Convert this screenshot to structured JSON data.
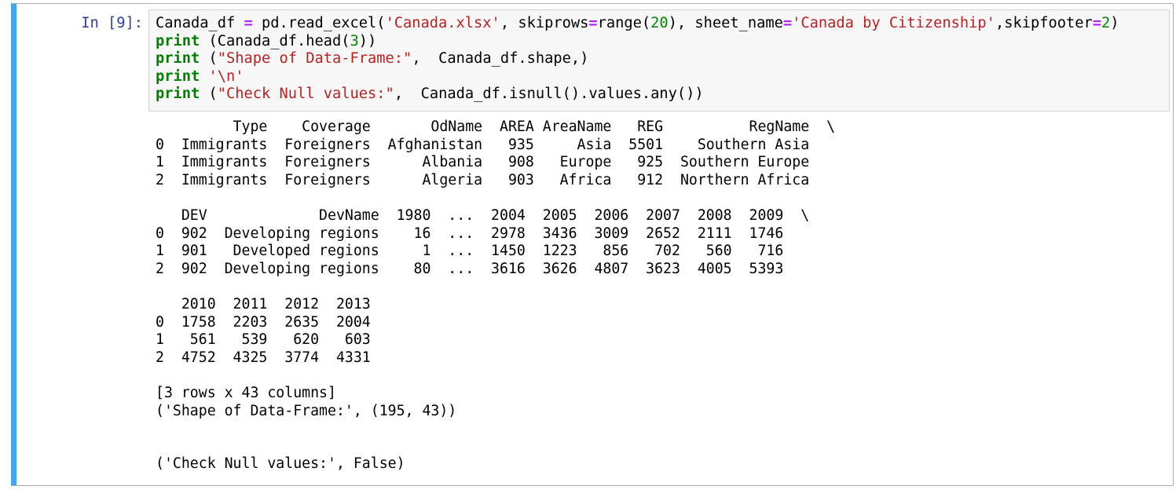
{
  "cell": {
    "prompt": "In [9]:",
    "accent_color": "#42A5F5",
    "code_lines": [
      [
        [
          "t",
          "Canada_df "
        ],
        [
          "op",
          "="
        ],
        [
          "t",
          " pd.read_excel("
        ],
        [
          "str",
          "'Canada.xlsx'"
        ],
        [
          "t",
          ", skiprows"
        ],
        [
          "op",
          "="
        ],
        [
          "t",
          "range("
        ],
        [
          "num",
          "20"
        ],
        [
          "t",
          "), sheet_name"
        ],
        [
          "op",
          "="
        ],
        [
          "str",
          "'Canada by Citizenship'"
        ],
        [
          "t",
          ",skipfooter"
        ],
        [
          "op",
          "="
        ],
        [
          "num",
          "2"
        ],
        [
          "t",
          ")"
        ]
      ],
      [
        [
          "kw",
          "print"
        ],
        [
          "t",
          " (Canada_df.head("
        ],
        [
          "num",
          "3"
        ],
        [
          "t",
          "))"
        ]
      ],
      [
        [
          "kw",
          "print"
        ],
        [
          "t",
          " ("
        ],
        [
          "str",
          "\"Shape of Data-Frame:\""
        ],
        [
          "t",
          ",  Canada_df.shape,)"
        ]
      ],
      [
        [
          "kw",
          "print"
        ],
        [
          "t",
          " "
        ],
        [
          "str",
          "'\\n'"
        ]
      ],
      [
        [
          "kw",
          "print"
        ],
        [
          "t",
          " ("
        ],
        [
          "str",
          "\"Check Null values:\""
        ],
        [
          "t",
          ",  Canada_df.isnull().values.any())"
        ]
      ]
    ],
    "output_lines": [
      "         Type    Coverage       OdName  AREA AreaName   REG          RegName  \\",
      "0  Immigrants  Foreigners  Afghanistan   935     Asia  5501    Southern Asia   ",
      "1  Immigrants  Foreigners      Albania   908   Europe   925  Southern Europe   ",
      "2  Immigrants  Foreigners      Algeria   903   Africa   912  Northern Africa   ",
      "",
      "   DEV             DevName  1980  ...  2004  2005  2006  2007  2008  2009  \\",
      "0  902  Developing regions    16  ...  2978  3436  3009  2652  2111  1746   ",
      "1  901   Developed regions     1  ...  1450  1223   856   702   560   716   ",
      "2  902  Developing regions    80  ...  3616  3626  4807  3623  4005  5393   ",
      "",
      "   2010  2011  2012  2013  ",
      "0  1758  2203  2635  2004  ",
      "1   561   539   620   603  ",
      "2  4752  4325  3774  4331  ",
      "",
      "[3 rows x 43 columns]",
      "('Shape of Data-Frame:', (195, 43))",
      "",
      "",
      "('Check Null values:', False)"
    ]
  }
}
